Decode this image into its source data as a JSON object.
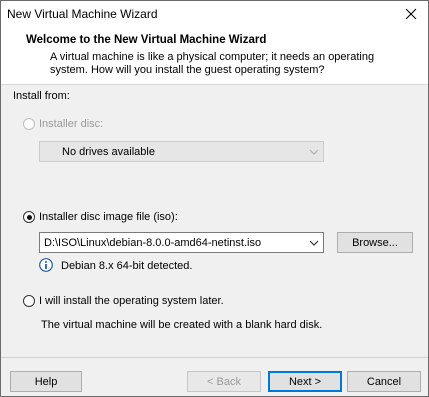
{
  "window": {
    "title": "New Virtual Machine Wizard"
  },
  "header": {
    "title": "Welcome to the New Virtual Machine Wizard",
    "description": "A virtual machine is like a physical computer; it needs an operating system. How will you install the guest operating system?"
  },
  "install": {
    "section_label": "Install from:",
    "disc_option": {
      "label": "Installer disc:",
      "selected": false,
      "enabled": false
    },
    "disc_drive": {
      "value": "No drives available",
      "enabled": false
    },
    "iso_option": {
      "label": "Installer disc image file (iso):",
      "selected": true,
      "enabled": true
    },
    "iso_path": {
      "value": "D:\\ISO\\Linux\\debian-8.0.0-amd64-netinst.iso"
    },
    "browse_label": "Browse...",
    "detected_text": "Debian 8.x 64-bit detected.",
    "later_option": {
      "label": "I will install the operating system later.",
      "selected": false,
      "enabled": true
    },
    "later_desc": "The virtual machine will be created with a blank hard disk."
  },
  "footer": {
    "help_label": "Help",
    "back_label": "< Back",
    "next_label": "Next >",
    "cancel_label": "Cancel"
  },
  "icons": {
    "close": "close-icon",
    "info": "info-icon",
    "dropdown": "chevron-down-icon"
  },
  "colors": {
    "default_button_border": "#0078d7",
    "info_icon": "#1f5fa8"
  }
}
